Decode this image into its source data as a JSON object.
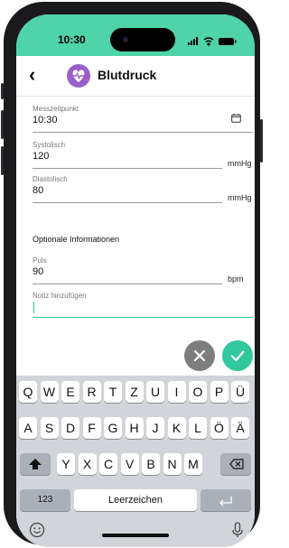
{
  "status": {
    "time": "10:30"
  },
  "header": {
    "back_icon": "chevron-left-icon",
    "title": "Blutdruck",
    "logo_color": "#9a5fc8"
  },
  "form": {
    "time": {
      "label": "Messzeitpunkt",
      "value": "10:30"
    },
    "systolic": {
      "label": "Systolisch",
      "value": "120",
      "unit": "mmHg"
    },
    "diastolic": {
      "label": "Diastolisch",
      "value": "80",
      "unit": "mmHg"
    },
    "optional_heading": "Optionale Informationen",
    "pulse": {
      "label": "Puls",
      "value": "90",
      "unit": "bpm"
    },
    "note": {
      "label": "Notiz hinzufügen",
      "value": ""
    }
  },
  "actions": {
    "cancel_icon": "close-icon",
    "confirm_icon": "check-icon",
    "cancel_color": "#7d7d7d",
    "confirm_color": "#33c79c"
  },
  "keyboard": {
    "row1": [
      "Q",
      "W",
      "E",
      "R",
      "T",
      "Z",
      "U",
      "I",
      "O",
      "P",
      "Ü"
    ],
    "row2": [
      "A",
      "S",
      "D",
      "F",
      "G",
      "H",
      "J",
      "K",
      "L",
      "Ö",
      "Ä"
    ],
    "row3": [
      "Y",
      "X",
      "C",
      "V",
      "B",
      "N",
      "M"
    ],
    "numbers": "123",
    "space": "Leerzeichen"
  },
  "colors": {
    "accent": "#4fd3a8",
    "input_active": "#33c79c"
  }
}
